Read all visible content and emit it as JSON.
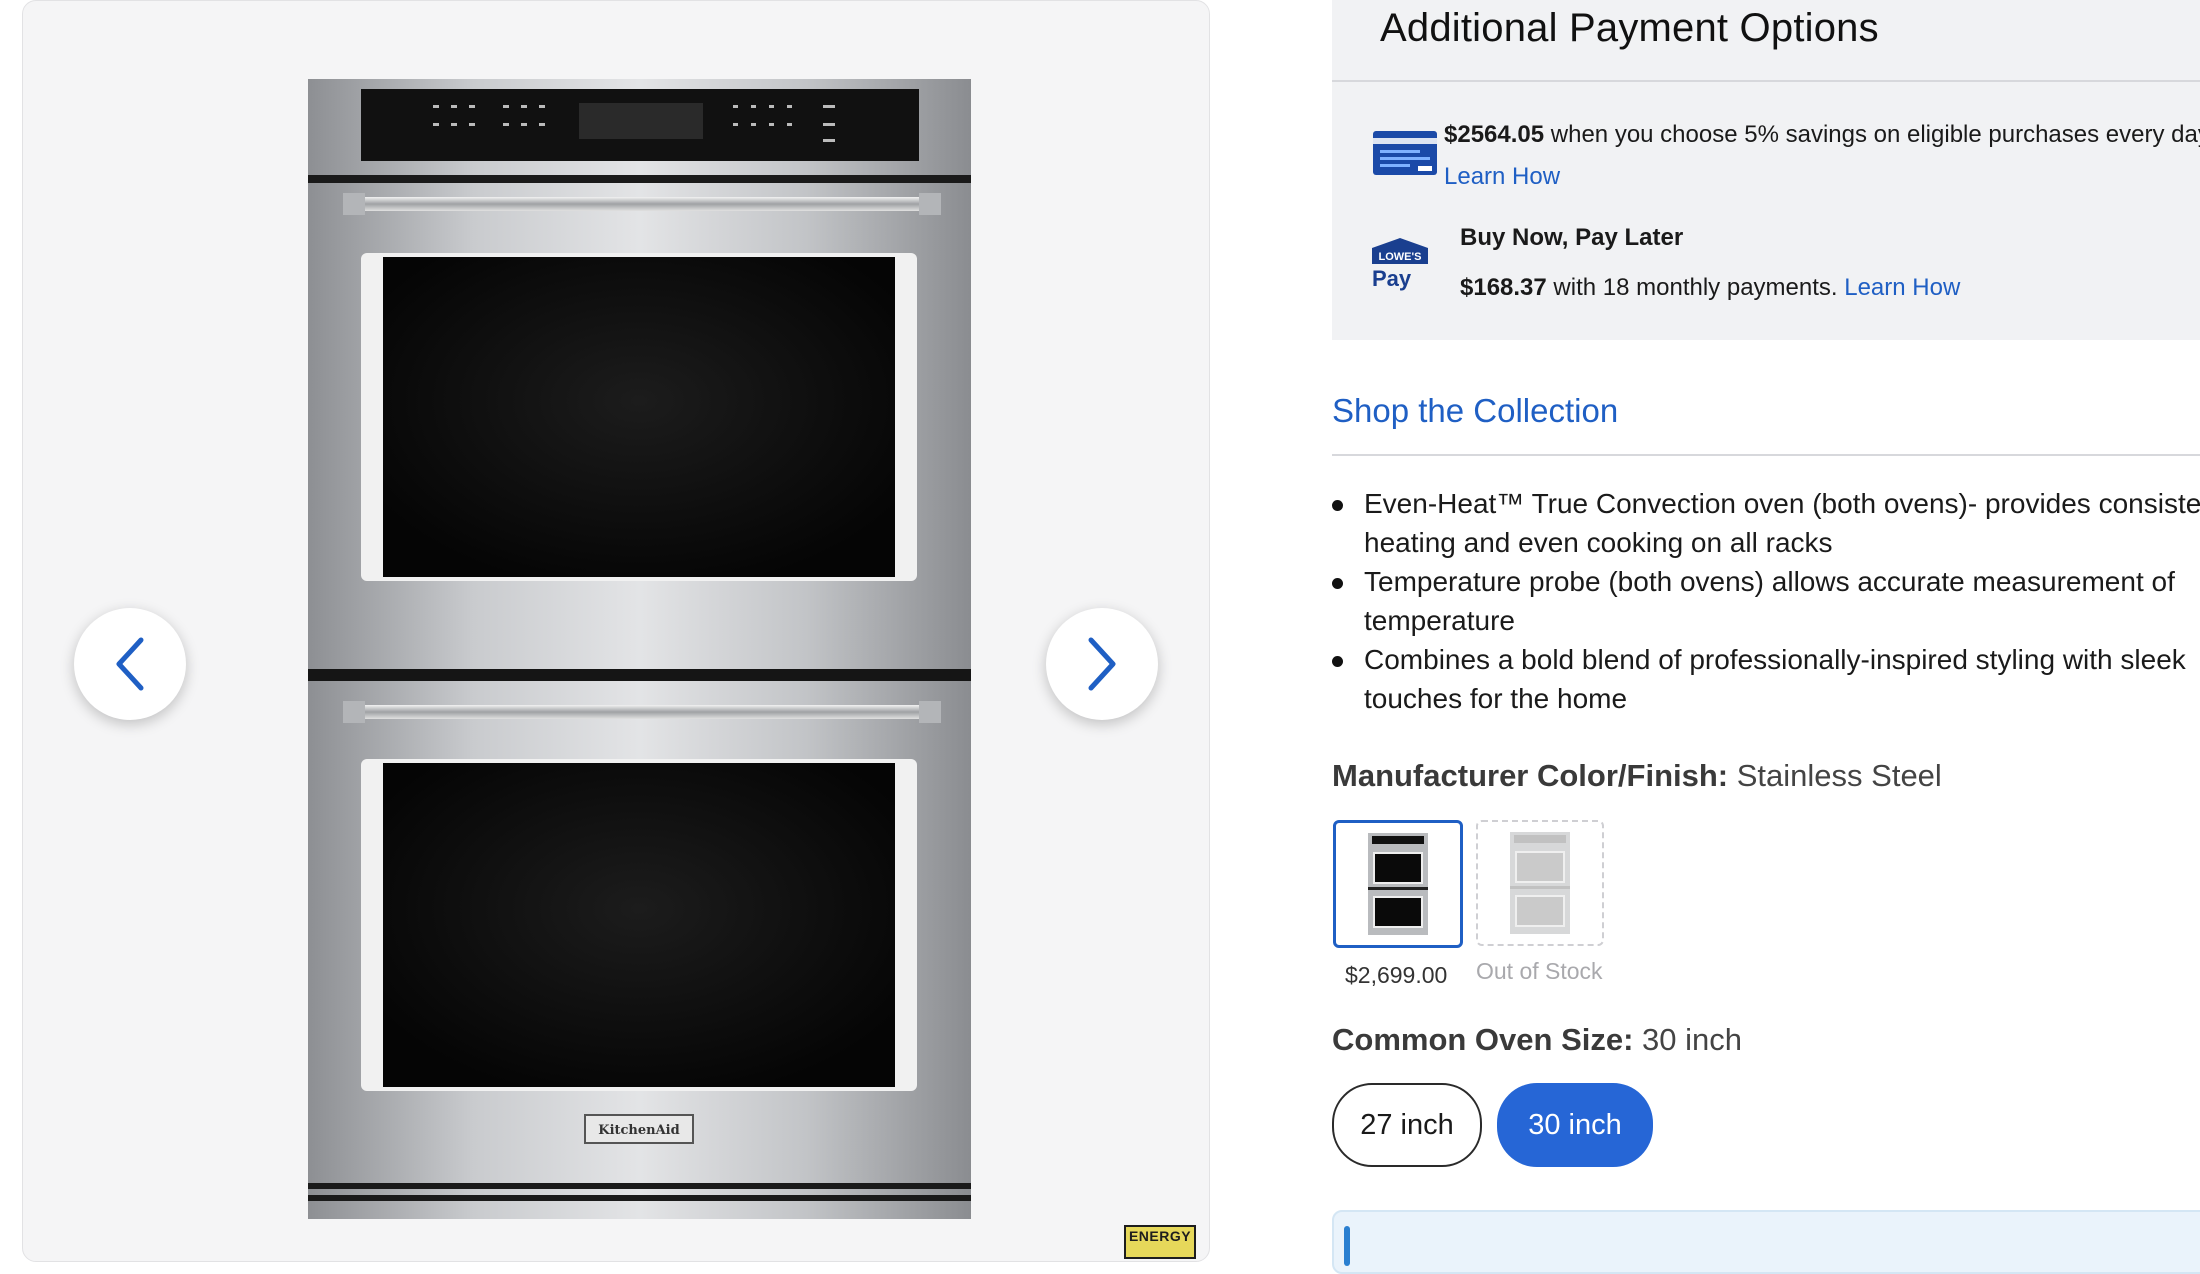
{
  "gallery": {
    "product_image": "stainless-steel-double-wall-oven",
    "brand_plate": "KitchenAid",
    "prev_icon": "chevron-left-icon",
    "next_icon": "chevron-right-icon",
    "energy_badge": "ENERGY"
  },
  "payment": {
    "title": "Additional Payment Options",
    "card_offer": {
      "amount": "$2564.05",
      "text": " when you choose 5% savings on eligible purchases every day. ",
      "link": "Learn How"
    },
    "pay_logo_top": "LOWE'S",
    "pay_logo_bottom": "Pay",
    "bnpl": {
      "title": "Buy Now, Pay Later",
      "amount": "$168.37",
      "text": " with 18 monthly payments. ",
      "link": "Learn How"
    }
  },
  "collection": {
    "title": "Shop the Collection"
  },
  "features": [
    "Even-Heat™ True Convection oven (both ovens)- provides consiste",
    "heating and even cooking on all racks",
    "Temperature probe (both ovens) allows accurate measurement of",
    "temperature",
    "Combines a bold blend of professionally-inspired styling with sleek",
    "touches for the home"
  ],
  "color_finish": {
    "label": "Manufacturer Color/Finish:",
    "value": " Stainless Steel",
    "options": [
      {
        "price": "$2,699.00",
        "selected": true
      },
      {
        "status": "Out of Stock",
        "selected": false
      }
    ]
  },
  "oven_size": {
    "label": "Common Oven Size:",
    "value": " 30 inch",
    "options": [
      "27 inch",
      "30 inch"
    ],
    "selected": "30 inch"
  },
  "colors": {
    "accent": "#1f5fc4",
    "selected_button": "#2666d6",
    "panel_bg": "#f1f2f4"
  }
}
